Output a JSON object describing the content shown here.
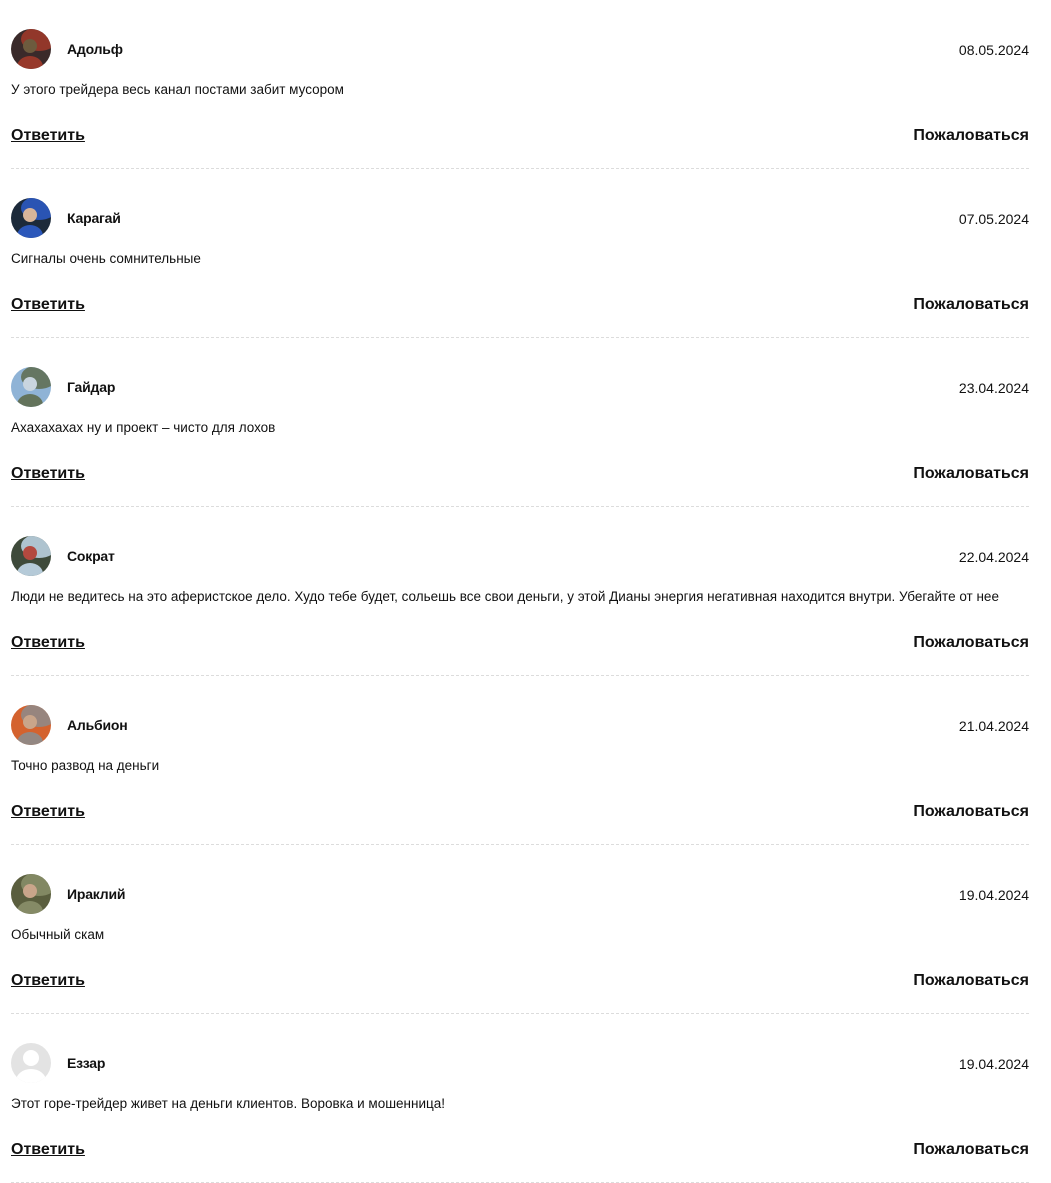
{
  "comments": [
    {
      "author": "Адольф",
      "date": "08.05.2024",
      "text": "У этого трейдера весь канал постами забит мусором",
      "reply_label": "Ответить",
      "report_label": "Пожаловаться",
      "avatar": "photo-avatar",
      "avatar_colors": [
        "#3a2a2a",
        "#a23a2a",
        "#6d5b3e"
      ]
    },
    {
      "author": "Карагай",
      "date": "07.05.2024",
      "text": "Сигналы очень сомнительные",
      "reply_label": "Ответить",
      "report_label": "Пожаловаться",
      "avatar": "photo-avatar",
      "avatar_colors": [
        "#1c2a3a",
        "#2d5cc9",
        "#d8b59a"
      ]
    },
    {
      "author": "Гайдар",
      "date": "23.04.2024",
      "text": "Ахахахахах ну и проект – чисто для лохов",
      "reply_label": "Ответить",
      "report_label": "Пожаловаться",
      "avatar": "photo-avatar",
      "avatar_colors": [
        "#8fb3d6",
        "#5e6b4e",
        "#c9d5df"
      ]
    },
    {
      "author": "Сократ",
      "date": "22.04.2024",
      "text": "Люди не ведитесь на это аферистское дело. Худо тебе будет, сольешь все свои деньги, у этой Дианы энергия негативная находится внутри. Убегайте от нее",
      "reply_label": "Ответить",
      "report_label": "Пожаловаться",
      "avatar": "photo-avatar",
      "avatar_colors": [
        "#3e4a3a",
        "#c2d8ea",
        "#b3493f"
      ]
    },
    {
      "author": "Альбион",
      "date": "21.04.2024",
      "text": "Точно развод на деньги",
      "reply_label": "Ответить",
      "report_label": "Пожаловаться",
      "avatar": "photo-avatar",
      "avatar_colors": [
        "#d4622e",
        "#8c8c8c",
        "#c9a58a"
      ]
    },
    {
      "author": "Ираклий",
      "date": "19.04.2024",
      "text": "Обычный скам",
      "reply_label": "Ответить",
      "report_label": "Пожаловаться",
      "avatar": "photo-avatar",
      "avatar_colors": [
        "#5a5e3e",
        "#8a8f6a",
        "#c9a58a"
      ]
    },
    {
      "author": "Еззар",
      "date": "19.04.2024",
      "text": "Этот горе-трейдер живет на деньги клиентов. Воровка и мошенница!",
      "reply_label": "Ответить",
      "report_label": "Пожаловаться",
      "avatar": "default-user-icon",
      "avatar_colors": [
        "#e3e3e3",
        "#ffffff",
        "#ffffff"
      ]
    }
  ]
}
